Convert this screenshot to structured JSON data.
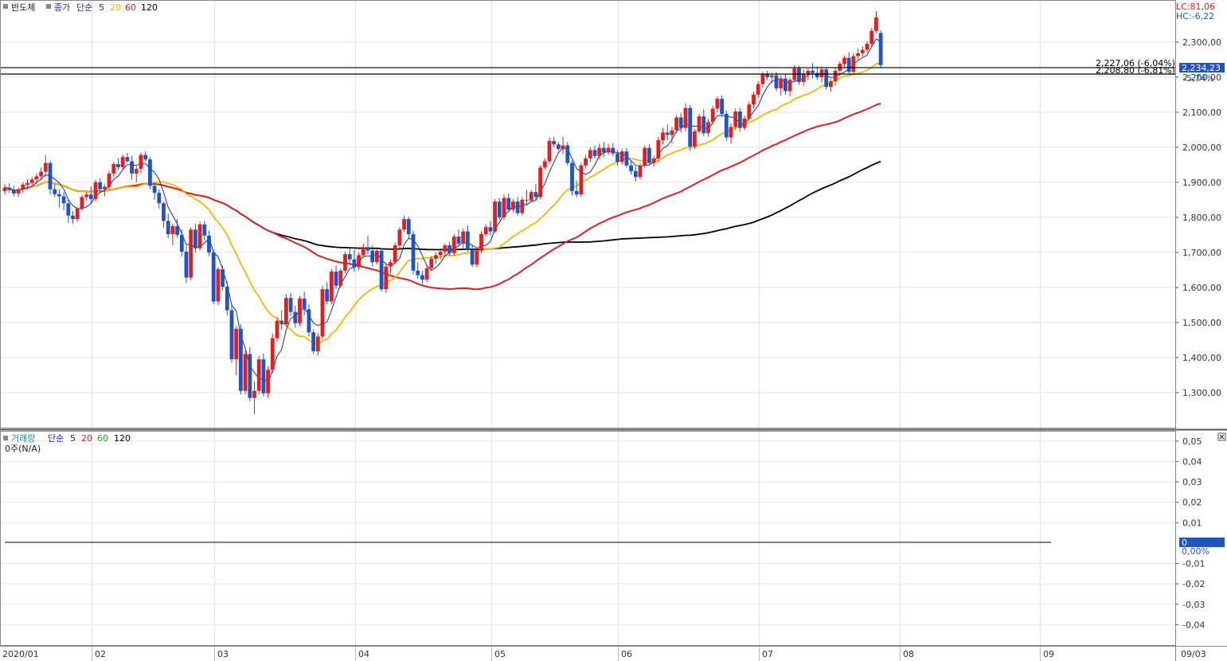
{
  "top_panel": {
    "legend": {
      "name": "반도체",
      "price_label": "종가",
      "ma_label": "단순",
      "ma_periods": [
        "5",
        "20",
        "60",
        "120"
      ]
    },
    "corner": {
      "lc": "LC:81,06",
      "hc": "HC:-6,22"
    },
    "price_tag": "2,234,23",
    "pct_tag": "-5,74%",
    "hline_labels": [
      "2,227,06 (-6,04%)",
      "2,208,80 (-6,81%)"
    ]
  },
  "bottom_panel": {
    "legend": {
      "name": "거래량",
      "ma_label": "단순",
      "ma_periods": [
        "5",
        "20",
        "60",
        "120"
      ]
    },
    "no_data": "0주(N/A)",
    "zero_tag": "0",
    "zero_pct": "0,00%"
  },
  "x_axis_labels": [
    "2020/01",
    "02",
    "03",
    "04",
    "05",
    "06",
    "07",
    "08",
    "09",
    "09/03"
  ],
  "colors": {
    "up": "#e0201f",
    "down": "#1f54c8",
    "ma5": "#1a2aa0",
    "ma20": "#f5b800",
    "ma60": "#e0201f",
    "ma120": "#000000"
  },
  "chart_data": [
    {
      "type": "candlestick",
      "series_name": "반도체",
      "ylim": [
        1200,
        2420
      ],
      "y_ticks": [
        "1,300,00",
        "1,400,00",
        "1,500,00",
        "1,600,00",
        "1,700,00",
        "1,800,00",
        "1,900,00",
        "2,000,00",
        "2,100,00",
        "2,200,00",
        "2,300,00"
      ],
      "y_tick_values": [
        1300,
        1400,
        1500,
        1600,
        1700,
        1800,
        1900,
        2000,
        2100,
        2200,
        2300
      ],
      "month_starts": [
        {
          "label": "2020/01",
          "index": 0
        },
        {
          "label": "02",
          "index": 20
        },
        {
          "label": "03",
          "index": 47
        },
        {
          "label": "04",
          "index": 78
        },
        {
          "label": "05",
          "index": 108
        },
        {
          "label": "06",
          "index": 136
        },
        {
          "label": "07",
          "index": 167
        },
        {
          "label": "08",
          "index": 198
        },
        {
          "label": "09",
          "index": 229
        }
      ],
      "candles": [
        [
          1875,
          1895,
          1865,
          1885
        ],
        [
          1885,
          1897,
          1870,
          1878
        ],
        [
          1878,
          1890,
          1860,
          1868
        ],
        [
          1868,
          1885,
          1858,
          1880
        ],
        [
          1880,
          1900,
          1870,
          1893
        ],
        [
          1893,
          1908,
          1880,
          1898
        ],
        [
          1898,
          1915,
          1888,
          1908
        ],
        [
          1908,
          1925,
          1895,
          1917
        ],
        [
          1917,
          1942,
          1905,
          1930
        ],
        [
          1930,
          1978,
          1915,
          1955
        ],
        [
          1955,
          1962,
          1865,
          1880
        ],
        [
          1880,
          1895,
          1858,
          1866
        ],
        [
          1866,
          1880,
          1828,
          1860
        ],
        [
          1860,
          1872,
          1820,
          1840
        ],
        [
          1840,
          1850,
          1785,
          1805
        ],
        [
          1805,
          1818,
          1782,
          1795
        ],
        [
          1795,
          1830,
          1787,
          1825
        ],
        [
          1825,
          1865,
          1818,
          1858
        ],
        [
          1858,
          1872,
          1848,
          1865
        ],
        [
          1865,
          1888,
          1840,
          1852
        ],
        [
          1852,
          1908,
          1845,
          1900
        ],
        [
          1900,
          1912,
          1870,
          1880
        ],
        [
          1880,
          1895,
          1860,
          1887
        ],
        [
          1887,
          1932,
          1878,
          1925
        ],
        [
          1925,
          1958,
          1915,
          1952
        ],
        [
          1952,
          1968,
          1935,
          1943
        ],
        [
          1943,
          1980,
          1935,
          1972
        ],
        [
          1972,
          1984,
          1955,
          1960
        ],
        [
          1960,
          1975,
          1908,
          1925
        ],
        [
          1925,
          1945,
          1900,
          1938
        ],
        [
          1938,
          1985,
          1925,
          1978
        ],
        [
          1978,
          1988,
          1958,
          1965
        ],
        [
          1965,
          1972,
          1880,
          1890
        ],
        [
          1890,
          1898,
          1850,
          1870
        ],
        [
          1870,
          1880,
          1825,
          1840
        ],
        [
          1840,
          1845,
          1770,
          1790
        ],
        [
          1790,
          1810,
          1740,
          1752
        ],
        [
          1752,
          1782,
          1720,
          1775
        ],
        [
          1775,
          1795,
          1742,
          1750
        ],
        [
          1750,
          1765,
          1688,
          1702
        ],
        [
          1702,
          1718,
          1612,
          1628
        ],
        [
          1628,
          1772,
          1620,
          1765
        ],
        [
          1765,
          1782,
          1700,
          1712
        ],
        [
          1712,
          1788,
          1705,
          1780
        ],
        [
          1780,
          1790,
          1735,
          1748
        ],
        [
          1748,
          1762,
          1690,
          1700
        ],
        [
          1700,
          1708,
          1552,
          1560
        ],
        [
          1560,
          1658,
          1550,
          1652
        ],
        [
          1652,
          1662,
          1592,
          1602
        ],
        [
          1602,
          1618,
          1520,
          1535
        ],
        [
          1535,
          1555,
          1385,
          1395
        ],
        [
          1395,
          1490,
          1350,
          1482
        ],
        [
          1482,
          1495,
          1295,
          1305
        ],
        [
          1305,
          1420,
          1295,
          1410
        ],
        [
          1410,
          1430,
          1275,
          1285
        ],
        [
          1285,
          1332,
          1238,
          1305
        ],
        [
          1305,
          1405,
          1295,
          1395
        ],
        [
          1395,
          1412,
          1290,
          1298
        ],
        [
          1298,
          1375,
          1285,
          1365
        ],
        [
          1365,
          1468,
          1355,
          1455
        ],
        [
          1455,
          1515,
          1445,
          1505
        ],
        [
          1505,
          1535,
          1480,
          1495
        ],
        [
          1495,
          1582,
          1488,
          1570
        ],
        [
          1570,
          1585,
          1518,
          1530
        ],
        [
          1530,
          1548,
          1485,
          1498
        ],
        [
          1498,
          1575,
          1490,
          1568
        ],
        [
          1568,
          1588,
          1520,
          1538
        ],
        [
          1538,
          1552,
          1460,
          1472
        ],
        [
          1472,
          1480,
          1410,
          1418
        ],
        [
          1418,
          1470,
          1405,
          1460
        ],
        [
          1460,
          1605,
          1452,
          1595
        ],
        [
          1595,
          1615,
          1552,
          1560
        ],
        [
          1560,
          1652,
          1552,
          1645
        ],
        [
          1645,
          1662,
          1595,
          1605
        ],
        [
          1605,
          1655,
          1598,
          1648
        ],
        [
          1648,
          1702,
          1640,
          1695
        ],
        [
          1695,
          1712,
          1670,
          1680
        ],
        [
          1680,
          1708,
          1645,
          1658
        ],
        [
          1658,
          1700,
          1650,
          1692
        ],
        [
          1692,
          1725,
          1685,
          1715
        ],
        [
          1715,
          1748,
          1695,
          1705
        ],
        [
          1705,
          1720,
          1660,
          1672
        ],
        [
          1672,
          1712,
          1665,
          1705
        ],
        [
          1705,
          1712,
          1588,
          1595
        ],
        [
          1595,
          1668,
          1585,
          1660
        ],
        [
          1660,
          1680,
          1640,
          1672
        ],
        [
          1672,
          1728,
          1665,
          1720
        ],
        [
          1720,
          1772,
          1712,
          1765
        ],
        [
          1765,
          1805,
          1758,
          1795
        ],
        [
          1795,
          1802,
          1740,
          1752
        ],
        [
          1752,
          1762,
          1638,
          1648
        ],
        [
          1648,
          1672,
          1625,
          1635
        ],
        [
          1635,
          1648,
          1610,
          1622
        ],
        [
          1622,
          1662,
          1615,
          1655
        ],
        [
          1655,
          1690,
          1648,
          1682
        ],
        [
          1682,
          1700,
          1668,
          1692
        ],
        [
          1692,
          1712,
          1680,
          1702
        ],
        [
          1702,
          1725,
          1688,
          1720
        ],
        [
          1720,
          1730,
          1690,
          1698
        ],
        [
          1698,
          1752,
          1690,
          1745
        ],
        [
          1745,
          1765,
          1718,
          1725
        ],
        [
          1725,
          1768,
          1712,
          1760
        ],
        [
          1760,
          1778,
          1702,
          1708
        ],
        [
          1708,
          1720,
          1658,
          1665
        ],
        [
          1665,
          1712,
          1658,
          1705
        ],
        [
          1705,
          1760,
          1698,
          1752
        ],
        [
          1752,
          1780,
          1745,
          1772
        ],
        [
          1772,
          1790,
          1748,
          1760
        ],
        [
          1760,
          1852,
          1755,
          1845
        ],
        [
          1845,
          1855,
          1792,
          1800
        ],
        [
          1800,
          1865,
          1792,
          1855
        ],
        [
          1855,
          1868,
          1815,
          1822
        ],
        [
          1822,
          1852,
          1815,
          1845
        ],
        [
          1845,
          1858,
          1805,
          1812
        ],
        [
          1812,
          1858,
          1805,
          1850
        ],
        [
          1850,
          1878,
          1835,
          1848
        ],
        [
          1848,
          1878,
          1842,
          1872
        ],
        [
          1872,
          1895,
          1850,
          1858
        ],
        [
          1858,
          1948,
          1852,
          1942
        ],
        [
          1942,
          1968,
          1935,
          1960
        ],
        [
          1960,
          2028,
          1952,
          2018
        ],
        [
          2018,
          2030,
          2000,
          2008
        ],
        [
          2008,
          2015,
          1990,
          1995
        ],
        [
          1995,
          2030,
          1980,
          2005
        ],
        [
          2005,
          2015,
          1948,
          1955
        ],
        [
          1955,
          1962,
          1862,
          1875
        ],
        [
          1875,
          1905,
          1858,
          1865
        ],
        [
          1865,
          1955,
          1858,
          1948
        ],
        [
          1948,
          1978,
          1940,
          1968
        ],
        [
          1968,
          2000,
          1958,
          1992
        ],
        [
          1992,
          2005,
          1968,
          1975
        ],
        [
          1975,
          2010,
          1965,
          1998
        ],
        [
          1998,
          2015,
          1972,
          1985
        ],
        [
          1985,
          2010,
          1978,
          1998
        ],
        [
          1998,
          2012,
          1975,
          1982
        ],
        [
          1982,
          1992,
          1948,
          1958
        ],
        [
          1958,
          1995,
          1950,
          1988
        ],
        [
          1988,
          1998,
          1942,
          1948
        ],
        [
          1948,
          1962,
          1922,
          1932
        ],
        [
          1932,
          1945,
          1902,
          1915
        ],
        [
          1915,
          1955,
          1908,
          1948
        ],
        [
          1948,
          2005,
          1942,
          1998
        ],
        [
          1998,
          2008,
          1948,
          1955
        ],
        [
          1955,
          1975,
          1945,
          1968
        ],
        [
          1968,
          2030,
          1958,
          2020
        ],
        [
          2020,
          2055,
          2008,
          2042
        ],
        [
          2042,
          2065,
          2020,
          2035
        ],
        [
          2035,
          2058,
          2010,
          2048
        ],
        [
          2048,
          2092,
          2040,
          2085
        ],
        [
          2085,
          2098,
          2042,
          2055
        ],
        [
          2055,
          2125,
          2045,
          2112
        ],
        [
          2112,
          2120,
          1990,
          2002
        ],
        [
          2002,
          2052,
          1995,
          2045
        ],
        [
          2045,
          2095,
          2040,
          2088
        ],
        [
          2088,
          2108,
          2032,
          2040
        ],
        [
          2040,
          2082,
          2030,
          2072
        ],
        [
          2072,
          2118,
          2065,
          2110
        ],
        [
          2110,
          2145,
          2100,
          2138
        ],
        [
          2138,
          2148,
          2085,
          2095
        ],
        [
          2095,
          2105,
          2018,
          2028
        ],
        [
          2028,
          2068,
          2010,
          2058
        ],
        [
          2058,
          2110,
          2050,
          2102
        ],
        [
          2102,
          2112,
          2045,
          2055
        ],
        [
          2055,
          2090,
          2048,
          2082
        ],
        [
          2082,
          2130,
          2075,
          2122
        ],
        [
          2122,
          2158,
          2110,
          2150
        ],
        [
          2150,
          2188,
          2140,
          2180
        ],
        [
          2180,
          2215,
          2170,
          2208
        ],
        [
          2208,
          2218,
          2192,
          2200
        ],
        [
          2200,
          2212,
          2182,
          2205
        ],
        [
          2205,
          2215,
          2160,
          2168
        ],
        [
          2168,
          2205,
          2148,
          2196
        ],
        [
          2196,
          2208,
          2150,
          2160
        ],
        [
          2160,
          2198,
          2145,
          2192
        ],
        [
          2192,
          2235,
          2185,
          2225
        ],
        [
          2225,
          2232,
          2178,
          2186
        ],
        [
          2186,
          2222,
          2175,
          2210
        ],
        [
          2210,
          2225,
          2192,
          2218
        ],
        [
          2218,
          2240,
          2196,
          2212
        ],
        [
          2212,
          2230,
          2192,
          2200
        ],
        [
          2200,
          2230,
          2185,
          2222
        ],
        [
          2222,
          2228,
          2165,
          2172
        ],
        [
          2172,
          2195,
          2158,
          2188
        ],
        [
          2188,
          2228,
          2175,
          2218
        ],
        [
          2218,
          2245,
          2205,
          2238
        ],
        [
          2238,
          2262,
          2225,
          2255
        ],
        [
          2255,
          2270,
          2208,
          2215
        ],
        [
          2215,
          2268,
          2208,
          2260
        ],
        [
          2260,
          2282,
          2245,
          2268
        ],
        [
          2268,
          2288,
          2258,
          2278
        ],
        [
          2278,
          2302,
          2270,
          2295
        ],
        [
          2295,
          2340,
          2288,
          2332
        ],
        [
          2332,
          2388,
          2325,
          2370
        ],
        [
          2326,
          2334,
          2226,
          2234
        ]
      ]
    },
    {
      "type": "line",
      "series_name": "거래량",
      "ylim": [
        -0.05,
        0.055
      ],
      "y_ticks": [
        "0,05",
        "0,04",
        "0,03",
        "0,02",
        "0,01",
        "-0,01",
        "-0,02",
        "-0,03",
        "-0,04"
      ],
      "y_tick_values": [
        0.05,
        0.04,
        0.03,
        0.02,
        0.01,
        -0.01,
        -0.02,
        -0.03,
        -0.04
      ],
      "values": [
        0
      ]
    }
  ]
}
